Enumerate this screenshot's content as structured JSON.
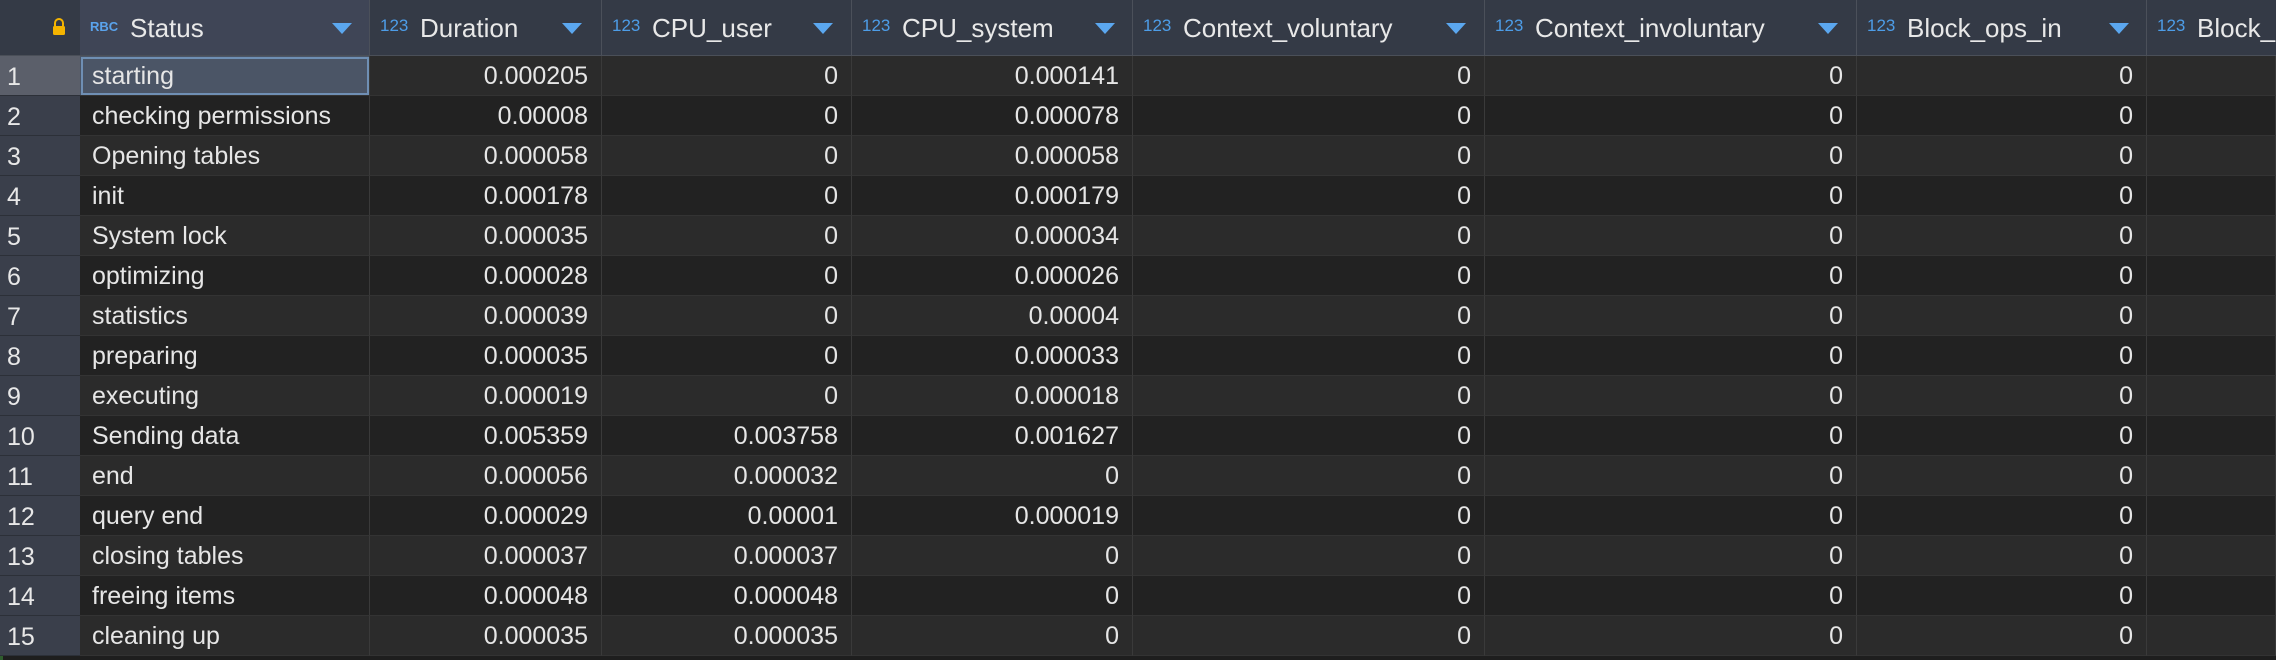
{
  "columns": [
    {
      "label": "Status",
      "type_badge": "RBC"
    },
    {
      "label": "Duration",
      "type_badge": "123"
    },
    {
      "label": "CPU_user",
      "type_badge": "123"
    },
    {
      "label": "CPU_system",
      "type_badge": "123"
    },
    {
      "label": "Context_voluntary",
      "type_badge": "123"
    },
    {
      "label": "Context_involuntary",
      "type_badge": "123"
    },
    {
      "label": "Block_ops_in",
      "type_badge": "123"
    },
    {
      "label": "Block_",
      "type_badge": "123"
    }
  ],
  "rows": [
    {
      "n": "1",
      "status": "starting",
      "duration": "0.000205",
      "cpu_user": "0",
      "cpu_system": "0.000141",
      "ctx_vol": "0",
      "ctx_invol": "0",
      "block_in": "0"
    },
    {
      "n": "2",
      "status": "checking permissions",
      "duration": "0.00008",
      "cpu_user": "0",
      "cpu_system": "0.000078",
      "ctx_vol": "0",
      "ctx_invol": "0",
      "block_in": "0"
    },
    {
      "n": "3",
      "status": "Opening tables",
      "duration": "0.000058",
      "cpu_user": "0",
      "cpu_system": "0.000058",
      "ctx_vol": "0",
      "ctx_invol": "0",
      "block_in": "0"
    },
    {
      "n": "4",
      "status": "init",
      "duration": "0.000178",
      "cpu_user": "0",
      "cpu_system": "0.000179",
      "ctx_vol": "0",
      "ctx_invol": "0",
      "block_in": "0"
    },
    {
      "n": "5",
      "status": "System lock",
      "duration": "0.000035",
      "cpu_user": "0",
      "cpu_system": "0.000034",
      "ctx_vol": "0",
      "ctx_invol": "0",
      "block_in": "0"
    },
    {
      "n": "6",
      "status": "optimizing",
      "duration": "0.000028",
      "cpu_user": "0",
      "cpu_system": "0.000026",
      "ctx_vol": "0",
      "ctx_invol": "0",
      "block_in": "0"
    },
    {
      "n": "7",
      "status": "statistics",
      "duration": "0.000039",
      "cpu_user": "0",
      "cpu_system": "0.00004",
      "ctx_vol": "0",
      "ctx_invol": "0",
      "block_in": "0"
    },
    {
      "n": "8",
      "status": "preparing",
      "duration": "0.000035",
      "cpu_user": "0",
      "cpu_system": "0.000033",
      "ctx_vol": "0",
      "ctx_invol": "0",
      "block_in": "0"
    },
    {
      "n": "9",
      "status": "executing",
      "duration": "0.000019",
      "cpu_user": "0",
      "cpu_system": "0.000018",
      "ctx_vol": "0",
      "ctx_invol": "0",
      "block_in": "0"
    },
    {
      "n": "10",
      "status": "Sending data",
      "duration": "0.005359",
      "cpu_user": "0.003758",
      "cpu_system": "0.001627",
      "ctx_vol": "0",
      "ctx_invol": "0",
      "block_in": "0"
    },
    {
      "n": "11",
      "status": "end",
      "duration": "0.000056",
      "cpu_user": "0.000032",
      "cpu_system": "0",
      "ctx_vol": "0",
      "ctx_invol": "0",
      "block_in": "0"
    },
    {
      "n": "12",
      "status": "query end",
      "duration": "0.000029",
      "cpu_user": "0.00001",
      "cpu_system": "0.000019",
      "ctx_vol": "0",
      "ctx_invol": "0",
      "block_in": "0"
    },
    {
      "n": "13",
      "status": "closing tables",
      "duration": "0.000037",
      "cpu_user": "0.000037",
      "cpu_system": "0",
      "ctx_vol": "0",
      "ctx_invol": "0",
      "block_in": "0"
    },
    {
      "n": "14",
      "status": "freeing items",
      "duration": "0.000048",
      "cpu_user": "0.000048",
      "cpu_system": "0",
      "ctx_vol": "0",
      "ctx_invol": "0",
      "block_in": "0"
    },
    {
      "n": "15",
      "status": "cleaning up",
      "duration": "0.000035",
      "cpu_user": "0.000035",
      "cpu_system": "0",
      "ctx_vol": "0",
      "ctx_invol": "0",
      "block_in": "0"
    }
  ],
  "icons": {
    "lock": "lock-icon",
    "sort": "chevron-down-icon"
  },
  "colors": {
    "accent": "#5ba7ef",
    "lock": "#f5b400"
  }
}
